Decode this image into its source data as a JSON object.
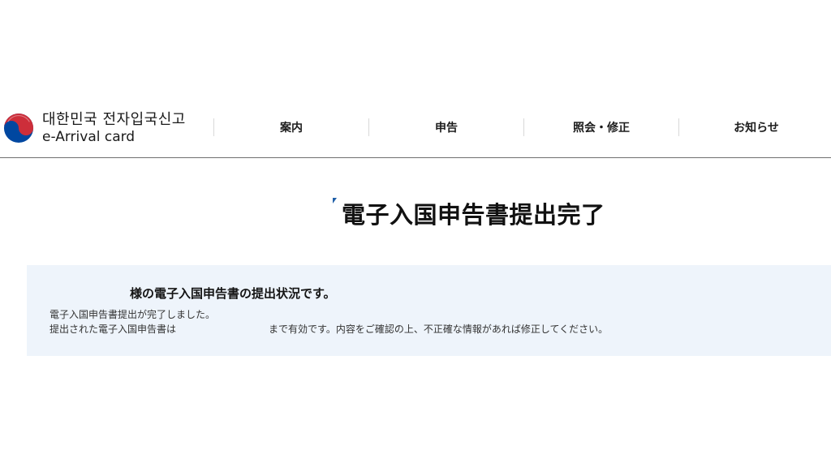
{
  "header": {
    "logo": {
      "korean": "대한민국 전자입국신고",
      "english": "e-Arrival card"
    },
    "nav": [
      {
        "label": "案内"
      },
      {
        "label": "申告"
      },
      {
        "label": "照会・修正"
      },
      {
        "label": "お知らせ"
      }
    ]
  },
  "main": {
    "title": "電子入国申告書提出完了",
    "status": {
      "heading": "様の電子入国申告書の提出状況です。",
      "line1": "電子入国申告書提出が完了しました。",
      "line2_prefix": "提出された電子入国申告書は",
      "line2_suffix": "まで有効です。内容をご確認の上、不正確な情報があれば修正してください。"
    }
  },
  "colors": {
    "accent": "#1f5fa8",
    "status_background": "#eef4fb",
    "header_border": "#6f6f6f",
    "emblem_red": "#cd2e3a",
    "emblem_blue": "#0047a0"
  }
}
